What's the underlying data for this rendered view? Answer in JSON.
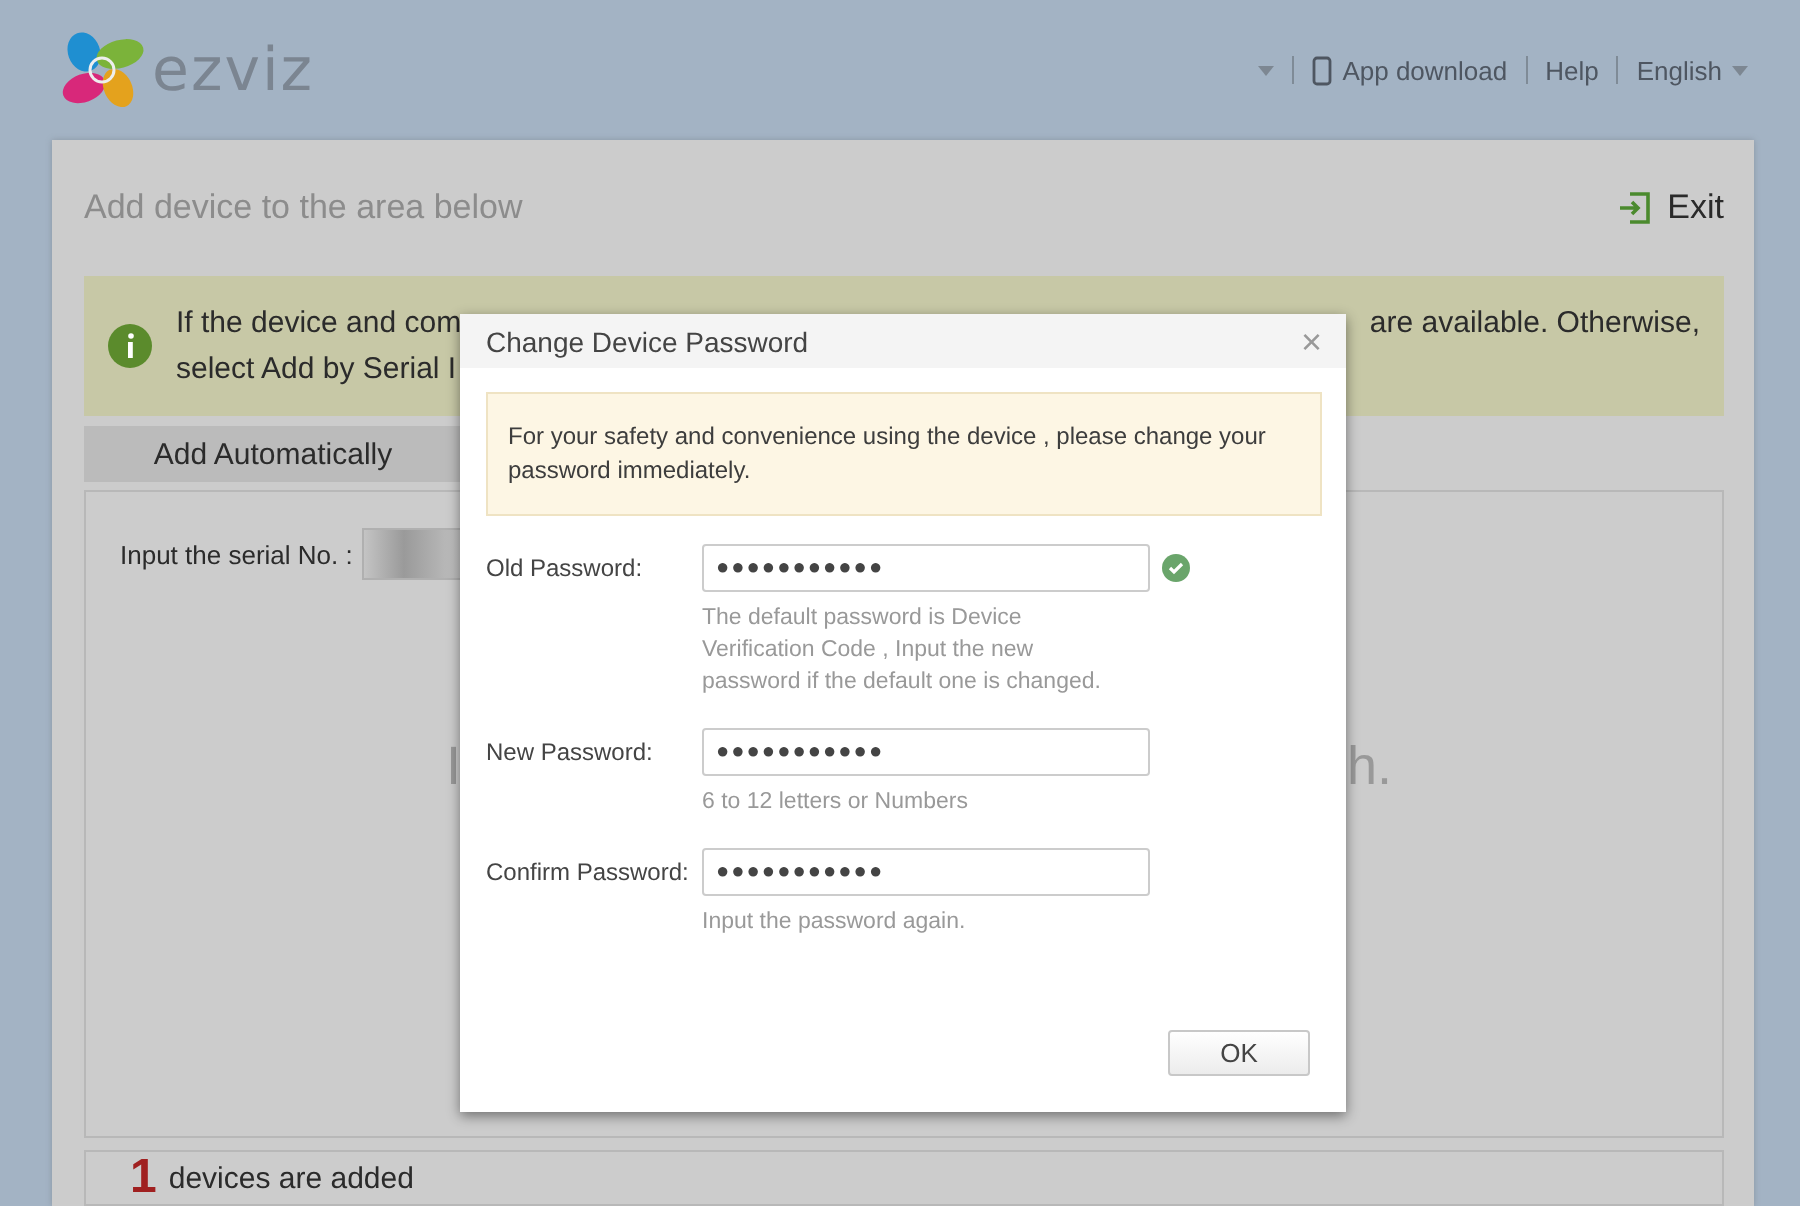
{
  "header": {
    "logo_text": "ezviz",
    "links": [
      {
        "kind": "caret"
      },
      {
        "kind": "app",
        "label": "App download"
      },
      {
        "kind": "plain",
        "label": "Help"
      },
      {
        "kind": "menu",
        "label": "English"
      }
    ]
  },
  "panel": {
    "title": "Add device to the area below",
    "exit": "Exit",
    "notice": {
      "line1_start": "If the device and com",
      "line1_end": "are available. Otherwise,",
      "line2": "select Add by Serial I"
    },
    "tabs": [
      {
        "label": "Add Automatically",
        "selected": true
      }
    ],
    "serial_label": "Input the serial No. :",
    "big_text_left": "I",
    "big_text_right": "h.",
    "count": "1",
    "count_text": "devices are added"
  },
  "dialog": {
    "title": "Change Device Password",
    "close": "×",
    "notice": "For your safety and convenience using the device , please change your password immediately.",
    "fields": [
      {
        "label": "Old Password:",
        "value": "●●●●●●●●●●●",
        "hint": "The default password is Device Verification Code , Input the new password if the default one is changed.",
        "valid": true
      },
      {
        "label": "New Password:",
        "value": "●●●●●●●●●●●",
        "hint": "6 to 12 letters or Numbers",
        "valid": false
      },
      {
        "label": "Confirm Password:",
        "value": "●●●●●●●●●●●",
        "hint": "Input the password again.",
        "valid": false
      }
    ],
    "ok": "OK"
  }
}
